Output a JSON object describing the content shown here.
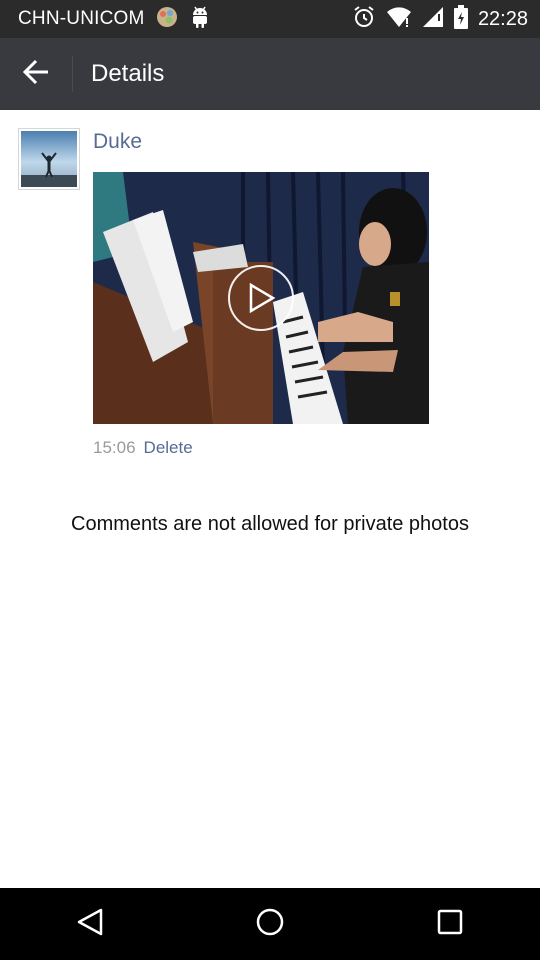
{
  "status_bar": {
    "carrier": "CHN-UNICOM",
    "time": "22:28",
    "icons": [
      "app-notification-icon",
      "android-icon",
      "alarm-icon",
      "wifi-icon",
      "signal-icon",
      "battery-icon"
    ]
  },
  "header": {
    "title": "Details",
    "back_icon": "arrow-left-icon"
  },
  "post": {
    "author": "Duke",
    "time": "15:06",
    "delete_label": "Delete",
    "media_type": "video",
    "play_icon": "play-icon"
  },
  "notice": "Comments are not allowed for private photos",
  "nav_bar": {
    "buttons": [
      "back-triangle-icon",
      "home-circle-icon",
      "recents-square-icon"
    ]
  },
  "colors": {
    "status_bar": "#2b2b2b",
    "title_bar": "#393a3f",
    "link": "#576b95",
    "time_text": "#9a9a9a",
    "nav_bar": "#000000"
  }
}
